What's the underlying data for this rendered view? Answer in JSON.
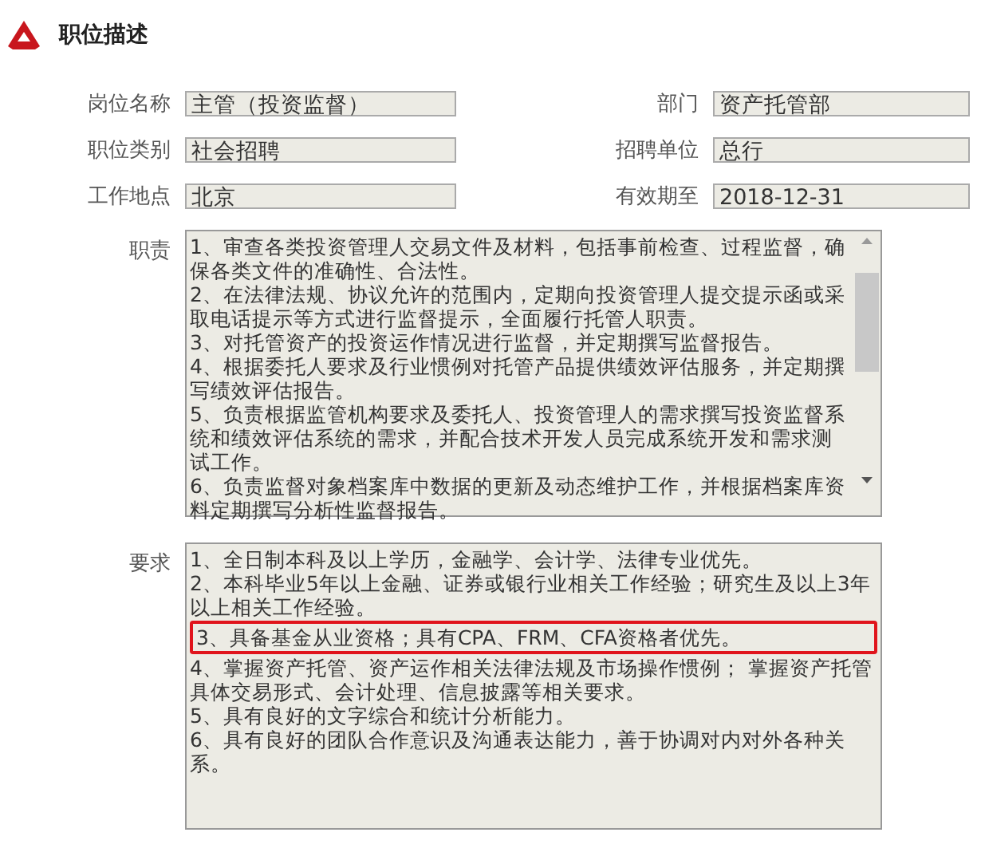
{
  "section": {
    "title": "职位描述"
  },
  "fields": [
    {
      "label": "岗位名称",
      "value": "主管（投资监督）"
    },
    {
      "label": "部门",
      "value": "资产托管部"
    },
    {
      "label": "职位类别",
      "value": "社会招聘"
    },
    {
      "label": "招聘单位",
      "value": "总行"
    },
    {
      "label": "工作地点",
      "value": "北京"
    },
    {
      "label": "有效期至",
      "value": "2018-12-31"
    }
  ],
  "text_areas": [
    {
      "label": "职责",
      "scrollbar": true,
      "lines": [
        {
          "text": "1、审查各类投资管理人交易文件及材料，包括事前检查、过程监督，确保各类文件的准确性、合法性。",
          "highlighted": false
        },
        {
          "text": "2、在法律法规、协议允许的范围内，定期向投资管理人提交提示函或采取电话提示等方式进行监督提示，全面履行托管人职责。",
          "highlighted": false
        },
        {
          "text": "3、对托管资产的投资运作情况进行监督，并定期撰写监督报告。",
          "highlighted": false
        },
        {
          "text": "4、根据委托人要求及行业惯例对托管产品提供绩效评估服务，并定期撰写绩效评估报告。",
          "highlighted": false
        },
        {
          "text": "5、负责根据监管机构要求及委托人、投资管理人的需求撰写投资监督系统和绩效评估系统的需求，并配合技术开发人员完成系统开发和需求测试工作。",
          "highlighted": false
        },
        {
          "text": "6、负责监督对象档案库中数据的更新及动态维护工作，并根据档案库资料定期撰写分析性监督报告。",
          "highlighted": false
        }
      ]
    },
    {
      "label": "要求",
      "scrollbar": false,
      "lines": [
        {
          "text": "1、全日制本科及以上学历，金融学、会计学、法律专业优先。",
          "highlighted": false
        },
        {
          "text": "2、本科毕业5年以上金融、证券或银行业相关工作经验；研究生及以上3年以上相关工作经验。",
          "highlighted": false
        },
        {
          "text": "3、具备基金从业资格；具有CPA、FRM、CFA资格者优先。",
          "highlighted": true
        },
        {
          "text": "4、掌握资产托管、资产运作相关法律法规及市场操作惯例； 掌握资产托管具体交易形式、会计处理、信息披露等相关要求。",
          "highlighted": false
        },
        {
          "text": "5、具有良好的文字综合和统计分析能力。",
          "highlighted": false
        },
        {
          "text": "6、具有良好的团队合作意识及沟通表达能力，善于协调对内对外各种关系。",
          "highlighted": false
        }
      ]
    }
  ]
}
